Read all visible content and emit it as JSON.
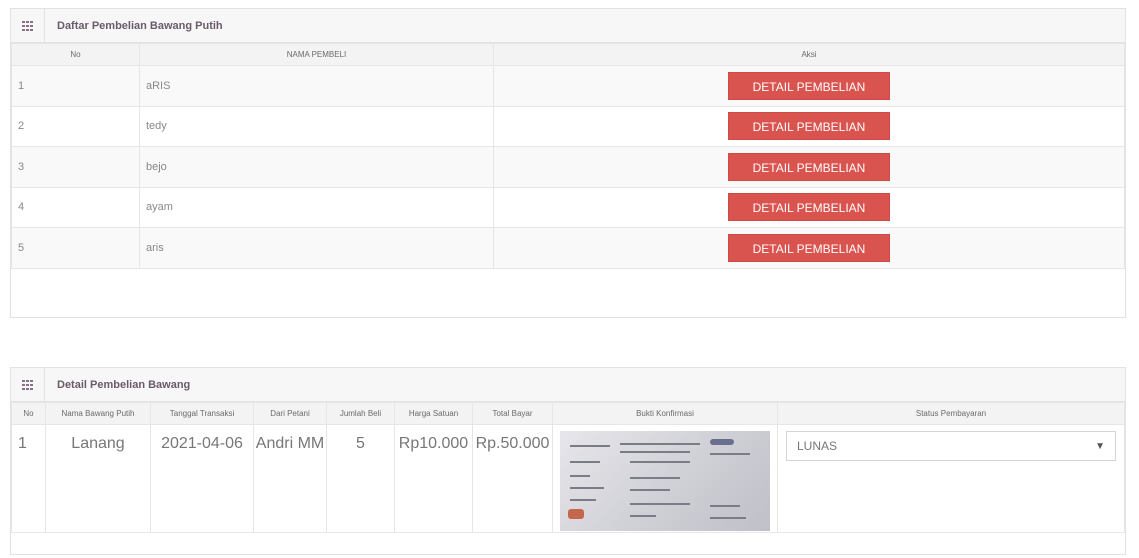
{
  "purchase_list": {
    "title": "Daftar Pembelian Bawang Putih",
    "columns": [
      "No",
      "NAMA PEMBELI",
      "Aksi"
    ],
    "rows": [
      {
        "no": "1",
        "name": "aRIS",
        "action": "DETAIL PEMBELIAN"
      },
      {
        "no": "2",
        "name": "tedy",
        "action": "DETAIL PEMBELIAN"
      },
      {
        "no": "3",
        "name": "bejo",
        "action": "DETAIL PEMBELIAN"
      },
      {
        "no": "4",
        "name": "ayam",
        "action": "DETAIL PEMBELIAN"
      },
      {
        "no": "5",
        "name": "aris",
        "action": "DETAIL PEMBELIAN"
      }
    ]
  },
  "purchase_detail": {
    "title": "Detail Pembelian Bawang",
    "columns": [
      "No",
      "Nama Bawang Putih",
      "Tanggal Transaksi",
      "Dari Petani",
      "Jumlah Beli",
      "Harga Satuan",
      "Total Bayar",
      "Bukti Konfirmasi",
      "Status Pembayaran"
    ],
    "row": {
      "no": "1",
      "nama_bawang": "Lanang",
      "tanggal": "2021-04-06",
      "petani": "Andri MM",
      "jumlah": "5",
      "harga": "Rp10.000",
      "total": "Rp.50.000",
      "status": "LUNAS"
    }
  },
  "icons": {
    "header": "table-grid-icon",
    "dropdown": "chevron-down-icon"
  },
  "colors": {
    "danger_button": "#d9534f",
    "header_bg": "#f7f7f7"
  }
}
